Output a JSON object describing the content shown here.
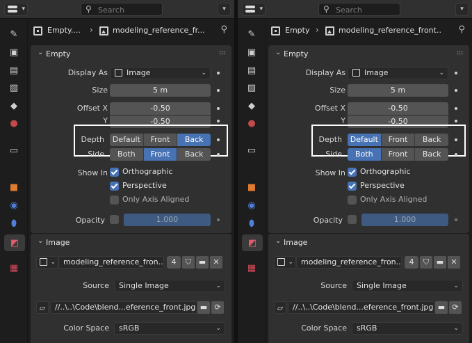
{
  "search": {
    "placeholder": "Search"
  },
  "panels": [
    {
      "breadcrumb": {
        "object": "Empty....",
        "image": "modeling_reference_fr..."
      },
      "empty": {
        "title": "Empty",
        "display_as_label": "Display As",
        "display_as_value": "Image",
        "size_label": "Size",
        "size_value": "5 m",
        "offset_x_label": "Offset X",
        "offset_x_value": "-0.50",
        "offset_y_label": "Y",
        "offset_y_value": "-0.50",
        "depth_label": "Depth",
        "depth_options": [
          "Default",
          "Front",
          "Back"
        ],
        "depth_selected": "Back",
        "side_label": "Side",
        "side_options": [
          "Both",
          "Front",
          "Back"
        ],
        "side_selected": "Front",
        "show_in_label": "Show In",
        "show_in": [
          {
            "label": "Orthographic",
            "checked": true
          },
          {
            "label": "Perspective",
            "checked": true
          },
          {
            "label": "Only Axis Aligned",
            "checked": false
          }
        ],
        "opacity_label": "Opacity",
        "opacity_value": "1.000"
      },
      "image": {
        "title": "Image",
        "datablock_name": "modeling_reference_fron...",
        "users": "4",
        "source_label": "Source",
        "source_value": "Single Image",
        "filepath": "//..\\..\\Code\\blend...eference_front.jpg",
        "color_space_label": "Color Space",
        "color_space_value": "sRGB"
      }
    },
    {
      "breadcrumb": {
        "object": "Empty",
        "image": "modeling_reference_front..."
      },
      "empty": {
        "title": "Empty",
        "display_as_label": "Display As",
        "display_as_value": "Image",
        "size_label": "Size",
        "size_value": "5 m",
        "offset_x_label": "Offset X",
        "offset_x_value": "-0.50",
        "offset_y_label": "Y",
        "offset_y_value": "-0.50",
        "depth_label": "Depth",
        "depth_options": [
          "Default",
          "Front",
          "Back"
        ],
        "depth_selected": "Default",
        "side_label": "Side",
        "side_options": [
          "Both",
          "Front",
          "Back"
        ],
        "side_selected": "Both",
        "show_in_label": "Show In",
        "show_in": [
          {
            "label": "Orthographic",
            "checked": true
          },
          {
            "label": "Perspective",
            "checked": true
          },
          {
            "label": "Only Axis Aligned",
            "checked": false
          }
        ],
        "opacity_label": "Opacity",
        "opacity_value": "1.000"
      },
      "image": {
        "title": "Image",
        "datablock_name": "modeling_reference_fron...",
        "users": "4",
        "source_label": "Source",
        "source_value": "Single Image",
        "filepath": "//..\\..\\Code\\blend...eference_front.jpg",
        "color_space_label": "Color Space",
        "color_space_value": "sRGB"
      }
    }
  ],
  "tabs": [
    {
      "icon": "tool-icon",
      "glyph": "✎",
      "color": "#cfcfcf"
    },
    {
      "icon": "render-icon",
      "glyph": "▣",
      "color": "#cfcfcf"
    },
    {
      "icon": "output-icon",
      "glyph": "▤",
      "color": "#cfcfcf"
    },
    {
      "icon": "view-layer-icon",
      "glyph": "▧",
      "color": "#cfcfcf"
    },
    {
      "icon": "scene-icon",
      "glyph": "◆",
      "color": "#cfcfcf"
    },
    {
      "icon": "world-icon",
      "glyph": "●",
      "color": "#c24a4a"
    },
    {
      "icon": "collection-icon",
      "glyph": "▭",
      "color": "#cfcfcf"
    },
    {
      "icon": "object-icon",
      "glyph": "■",
      "color": "#e07b2f"
    },
    {
      "icon": "physics-icon",
      "glyph": "◉",
      "color": "#4f7fd6"
    },
    {
      "icon": "constraints-icon",
      "glyph": "⬮",
      "color": "#4f7fd6"
    },
    {
      "icon": "image-data-icon",
      "glyph": "◩",
      "color": "#e05a6a"
    },
    {
      "icon": "texture-icon",
      "glyph": "▦",
      "color": "#d94a5a"
    }
  ],
  "colors": {
    "accent": "#4772b3",
    "panel": "#303030",
    "background": "#1d1d1d",
    "highlight_box": "#ffffff"
  }
}
